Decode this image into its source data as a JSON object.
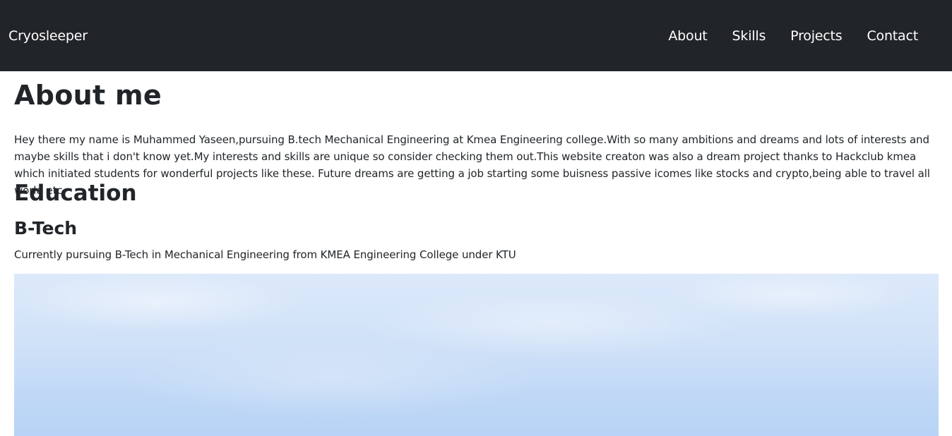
{
  "navbar": {
    "brand": "Cryosleeper",
    "links": [
      {
        "label": "About"
      },
      {
        "label": "Skills"
      },
      {
        "label": "Projects"
      },
      {
        "label": "Contact"
      }
    ],
    "background": "#212529"
  },
  "about": {
    "title": "About me",
    "text": "Hey there my name is Muhammed Yaseen,pursuing B.tech Mechanical Engineering at Kmea Engineering college.With so many ambitions and dreams and lots of interests and maybe skills that i don't know yet.My interests and skills are unique so consider checking them out.This website creaton was also a dream project thanks to Hackclub kmea which initiated students for wonderful projects like these. Future dreams are getting a job starting some buisness passive icomes like stocks and crypto,being able to travel all world etc."
  },
  "education": {
    "title": "Education",
    "degree_title": "B-Tech",
    "degree_text": "Currently pursuing B-Tech in Mechanical Engineering from KMEA Engineering College under KTU"
  }
}
